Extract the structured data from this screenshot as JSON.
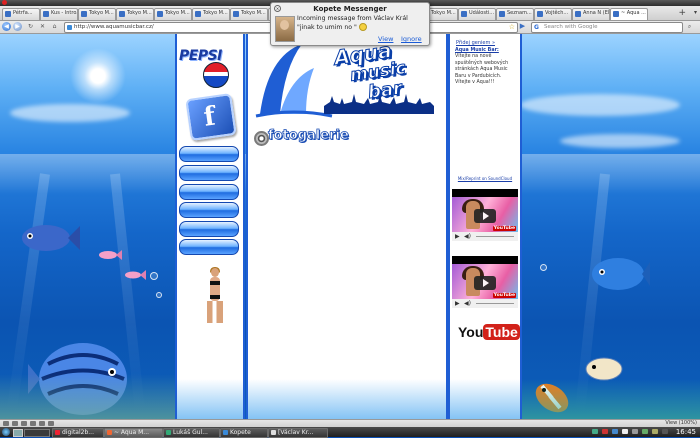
{
  "browser": {
    "tabs": [
      {
        "label": "Pétrfa..."
      },
      {
        "label": "Kus - Intro..."
      },
      {
        "label": "Tokyo M..."
      },
      {
        "label": "Tokyo M..."
      },
      {
        "label": "Tokyo M..."
      },
      {
        "label": "Tokyo M..."
      },
      {
        "label": "Tokyo M..."
      },
      {
        "label": "Tokyo M..."
      },
      {
        "label": "Tokyo M..."
      },
      {
        "label": "Tokyo M..."
      },
      {
        "label": "Tokyo M..."
      },
      {
        "label": "Tokyo M..."
      },
      {
        "label": "Události..."
      },
      {
        "label": "Seznam..."
      },
      {
        "label": "Vojtěch..."
      },
      {
        "label": "Anna N (Ele..."
      },
      {
        "label": "~ Aqua ..."
      }
    ],
    "url": "http://www.aquamusicbar.cz/",
    "search_placeholder": "Search with Google",
    "status_zoom": "View (100%)"
  },
  "site": {
    "pepsi": "PEPSI",
    "facebook_glyph": "f",
    "logo_words": [
      "Aqua",
      "music",
      "bar"
    ],
    "gallery_title": "fotogalerie",
    "friend_link": "Přidej geniem »",
    "info_lead": "Aqua Music Bar:",
    "info_body": "Vítejte na nově spuštěných webových stránkách Aqua Music Baru v Pardubicích. Vítejte v Aqua!!!",
    "soundcloud": "Mix/Reprint on SoundCloud",
    "youtube_you": "You",
    "youtube_tube": "Tube",
    "video_badge": "YouTube"
  },
  "notification": {
    "title": "Kopete Messenger",
    "line1": "Incoming message from Václav Král",
    "line2": "\"jinak to umim no \"",
    "view": "View",
    "ignore": "Ignore"
  },
  "taskbar": {
    "tasks": [
      {
        "label": "digital2b..."
      },
      {
        "label": "~ Aqua M..."
      },
      {
        "label": "Lukáš Gul..."
      },
      {
        "label": "Kopete"
      },
      {
        "label": "[Václav Kr..."
      }
    ],
    "clock": "16:45"
  },
  "colors": {
    "accent": "#1f5ed4",
    "youtube_red": "#d2221a",
    "link": "#1a5bd6"
  }
}
